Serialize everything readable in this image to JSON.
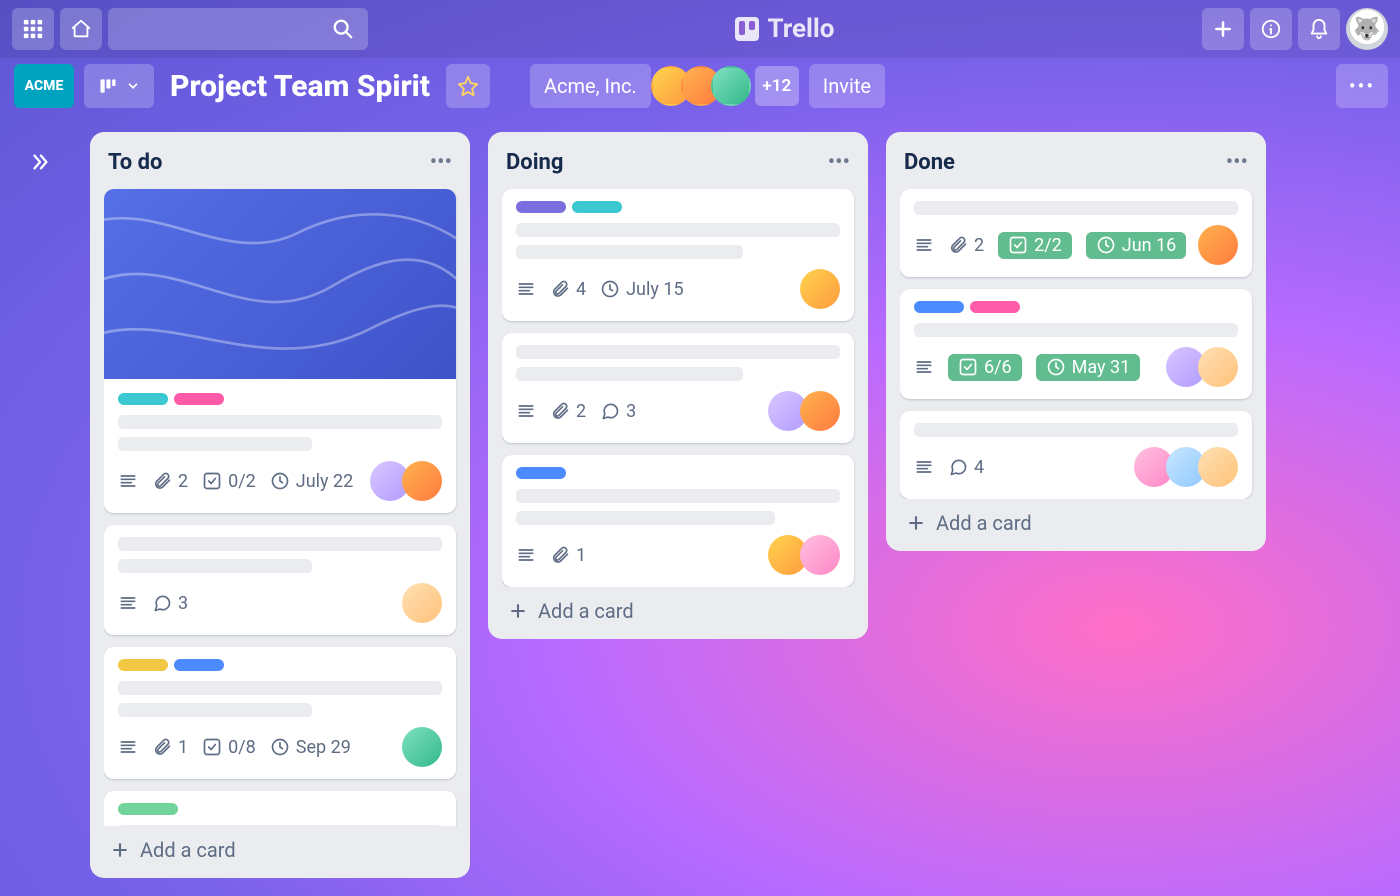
{
  "app": {
    "name": "Trello"
  },
  "workspace": {
    "chip": "ACME"
  },
  "board": {
    "title": "Project Team Spirit",
    "org": "Acme, Inc.",
    "extraMembers": "+12",
    "invite": "Invite"
  },
  "avatarColors": {
    "a1": "linear-gradient(135deg,#ffd34e,#ff9b3f)",
    "a2": "linear-gradient(135deg,#ffb24e,#ff7b3f)",
    "a3": "linear-gradient(135deg,#7ee0c0,#34b98a)",
    "a4": "linear-gradient(135deg,#d9c7ff,#b19bff)",
    "a5": "linear-gradient(135deg,#ffc0e0,#ff87c6)",
    "a6": "linear-gradient(135deg,#c9e7ff,#8fc8ff)",
    "a7": "linear-gradient(135deg,#ffe0b3,#ffc27a)"
  },
  "labelColors": {
    "teal": "#3cc8d1",
    "pink": "#ff5ba8",
    "yellow": "#f2c744",
    "blue": "#4c8bff",
    "green": "#72d49b",
    "purple": "#7b6fe0"
  },
  "lists": [
    {
      "title": "To do",
      "addCard": "Add a card",
      "cards": [
        {
          "cover": true,
          "labels": [
            "teal",
            "pink"
          ],
          "lines": [
            100,
            60
          ],
          "badges": {
            "desc": true,
            "attach": "2",
            "check": "0/2",
            "due": "July 22"
          },
          "members": [
            "a4",
            "a2"
          ]
        },
        {
          "lines": [
            100,
            60
          ],
          "badges": {
            "desc": true,
            "comments": "3"
          },
          "members": [
            "a7"
          ]
        },
        {
          "labels": [
            "yellow",
            "blue"
          ],
          "lines": [
            100,
            60
          ],
          "badges": {
            "desc": true,
            "attach": "1",
            "check": "0/8",
            "due": "Sep 29"
          },
          "members": [
            "a3"
          ]
        },
        {
          "labels": [
            "green"
          ],
          "lines": [
            100
          ]
        }
      ]
    },
    {
      "title": "Doing",
      "addCard": "Add a card",
      "cards": [
        {
          "labels": [
            "purple",
            "teal"
          ],
          "lines": [
            100,
            70
          ],
          "badges": {
            "desc": true,
            "attach": "4",
            "due": "July 15"
          },
          "members": [
            "a1"
          ]
        },
        {
          "lines": [
            100,
            70
          ],
          "badges": {
            "desc": true,
            "comments": "3",
            "attach": "2"
          },
          "members": [
            "a4",
            "a2"
          ]
        },
        {
          "labels": [
            "blue"
          ],
          "lines": [
            100,
            80
          ],
          "badges": {
            "desc": true,
            "attach": "1"
          },
          "members": [
            "a1",
            "a5"
          ]
        }
      ]
    },
    {
      "title": "Done",
      "addCard": "Add a card",
      "cards": [
        {
          "lines": [
            100
          ],
          "badges": {
            "desc": true,
            "attach": "2",
            "checkDone": "2/2",
            "dueDone": "Jun 16"
          },
          "members": [
            "a2"
          ]
        },
        {
          "labels": [
            "blue",
            "pink"
          ],
          "lines": [
            100
          ],
          "badges": {
            "desc": true,
            "checkDone": "6/6",
            "dueDone": "May 31"
          },
          "members": [
            "a4",
            "a7"
          ]
        },
        {
          "lines": [
            100
          ],
          "badges": {
            "desc": true,
            "comments": "4"
          },
          "members": [
            "a5",
            "a6",
            "a7"
          ]
        }
      ]
    }
  ]
}
